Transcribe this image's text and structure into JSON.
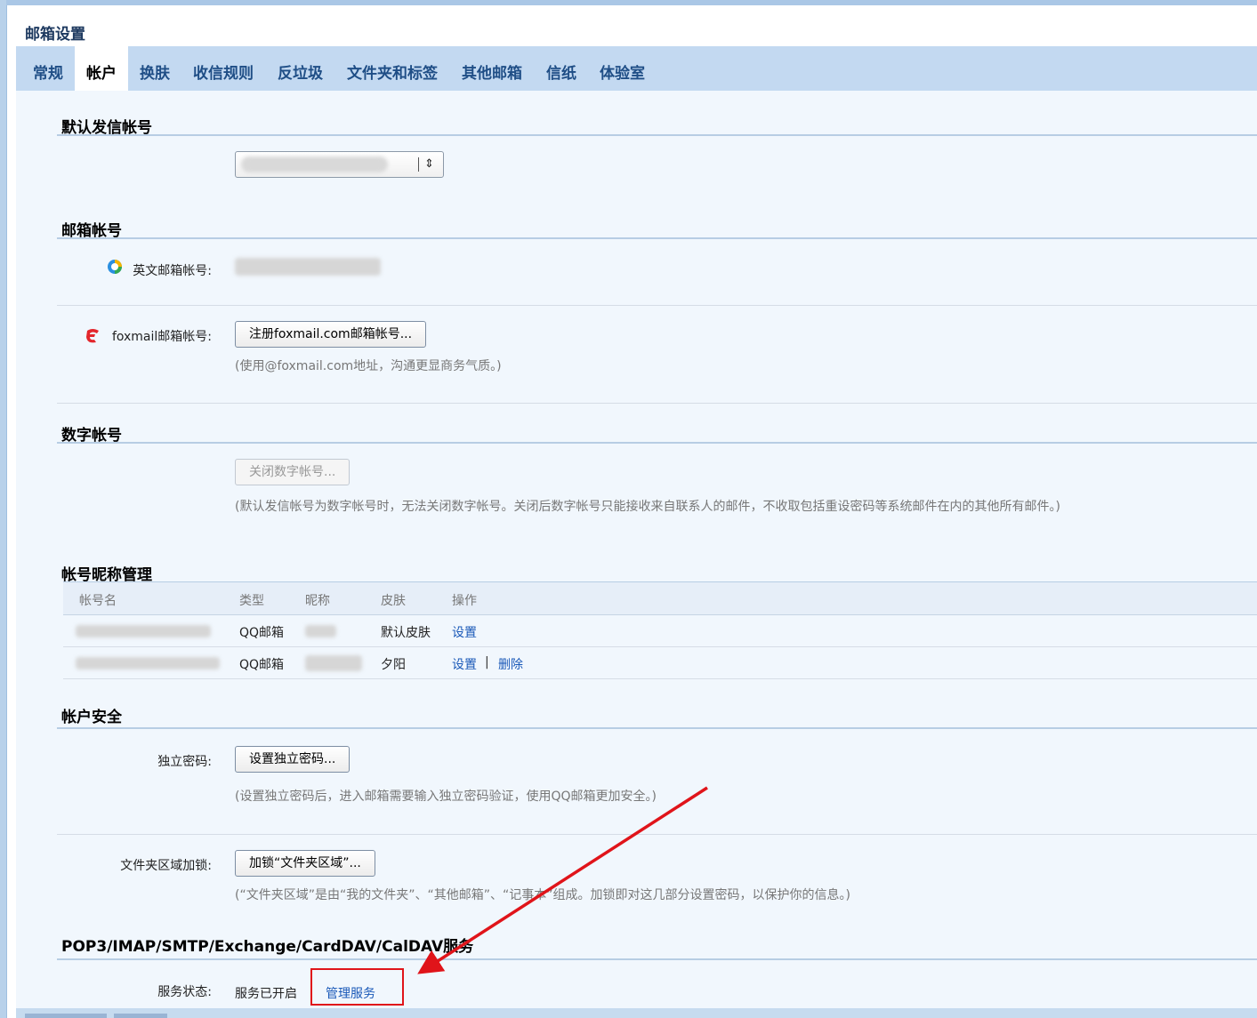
{
  "window": {
    "title": "邮箱设置"
  },
  "tabs": [
    {
      "label": "常规"
    },
    {
      "label": "帐户",
      "active": true
    },
    {
      "label": "换肤"
    },
    {
      "label": "收信规则"
    },
    {
      "label": "反垃圾"
    },
    {
      "label": "文件夹和标签"
    },
    {
      "label": "其他邮箱"
    },
    {
      "label": "信纸"
    },
    {
      "label": "体验室"
    }
  ],
  "default_sender": {
    "title": "默认发信帐号",
    "select_arrow": "⇕"
  },
  "mailbox_account": {
    "title": "邮箱帐号",
    "english_label": "英文邮箱帐号:",
    "foxmail_label": "foxmail邮箱帐号:",
    "foxmail_button": "注册foxmail.com邮箱帐号...",
    "foxmail_hint": "(使用@foxmail.com地址，沟通更显商务气质。)"
  },
  "digital_account": {
    "title": "数字帐号",
    "button": "关闭数字帐号...",
    "hint": "(默认发信帐号为数字帐号时，无法关闭数字帐号。关闭后数字帐号只能接收来自联系人的邮件，不收取包括重设密码等系统邮件在内的其他所有邮件。)"
  },
  "nickname": {
    "title": "帐号昵称管理",
    "headers": {
      "name": "帐号名",
      "type": "类型",
      "nick": "昵称",
      "skin": "皮肤",
      "action": "操作"
    },
    "rows": [
      {
        "type": "QQ邮箱",
        "skin": "默认皮肤",
        "set": "设置"
      },
      {
        "type": "QQ邮箱",
        "skin": "夕阳",
        "set": "设置",
        "sep": "|",
        "del": "删除"
      }
    ]
  },
  "security": {
    "title": "帐户安全",
    "pwd_label": "独立密码:",
    "pwd_button": "设置独立密码...",
    "pwd_hint": "(设置独立密码后，进入邮箱需要输入独立密码验证，使用QQ邮箱更加安全。)",
    "lock_label": "文件夹区域加锁:",
    "lock_button": "加锁“文件夹区域”...",
    "lock_hint": "(“文件夹区域”是由“我的文件夹”、“其他邮箱”、“记事本”组成。加锁即对这几部分设置密码，以保护你的信息。)"
  },
  "pop3": {
    "title": "POP3/IMAP/SMTP/Exchange/CardDAV/CalDAV服务",
    "status_label": "服务状态:",
    "status_value": "服务已开启",
    "manage_link": "管理服务"
  },
  "colors": {
    "accent_link": "#1a59b8",
    "tabbar": "#c3d9f1",
    "annotation_red": "#e0141a"
  }
}
